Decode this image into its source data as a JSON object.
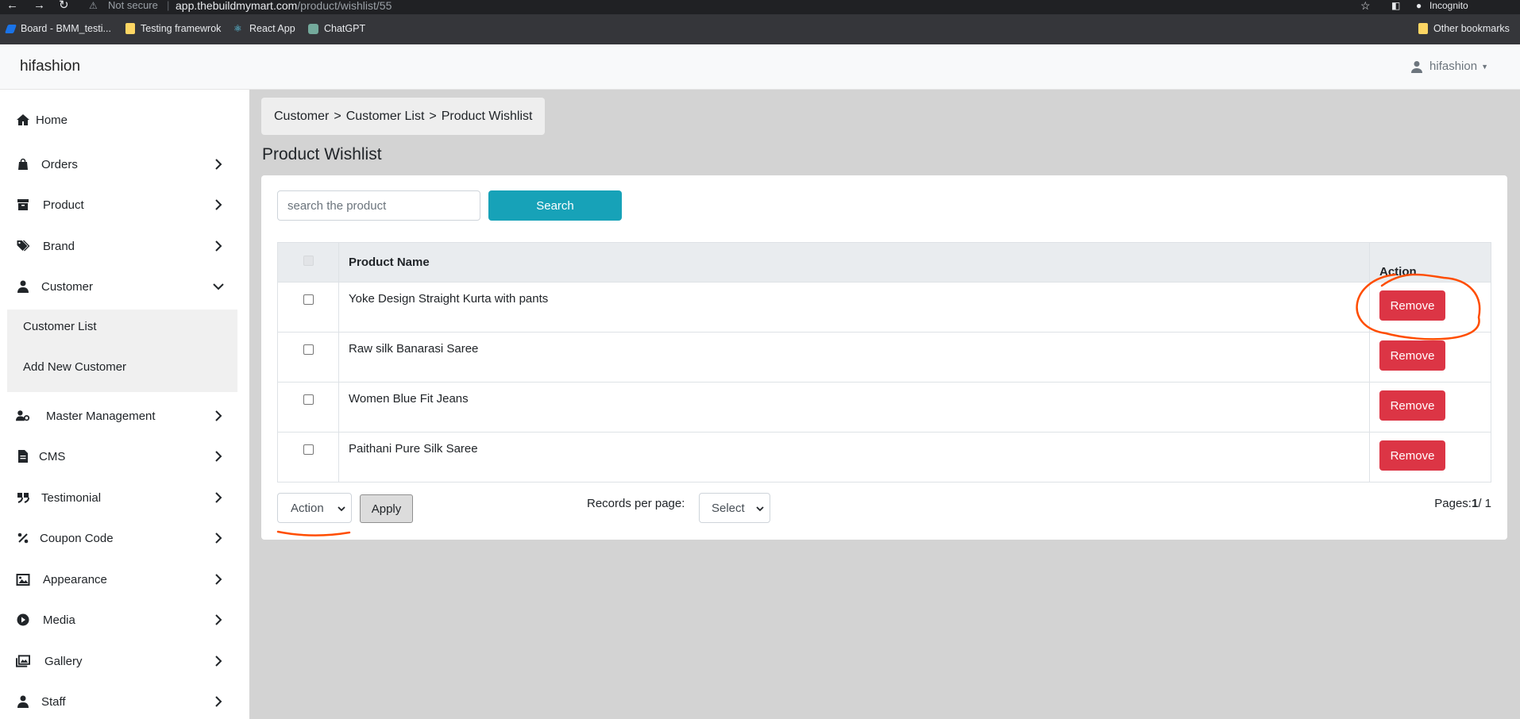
{
  "browser": {
    "not_secure": "Not secure",
    "url_host": "app.thebuildmymart.com",
    "url_path": "/product/wishlist/55",
    "profile": "Incognito",
    "bookmarks": [
      "Board - BMM_testi...",
      "Testing framewrok",
      "React App",
      "ChatGPT"
    ],
    "other_bookmarks": "Other bookmarks"
  },
  "header": {
    "brand": "hifashion",
    "user": "hifashion"
  },
  "sidebar": {
    "items": [
      {
        "label": "Home",
        "icon": "home-icon"
      },
      {
        "label": "Orders",
        "icon": "bag-icon"
      },
      {
        "label": "Product",
        "icon": "archive-icon"
      },
      {
        "label": "Brand",
        "icon": "tags-icon"
      },
      {
        "label": "Customer",
        "icon": "user-icon"
      },
      {
        "label": "Master Management",
        "icon": "user-cog-icon"
      },
      {
        "label": "CMS",
        "icon": "file-icon"
      },
      {
        "label": "Testimonial",
        "icon": "quote-icon"
      },
      {
        "label": "Coupon Code",
        "icon": "percent-icon"
      },
      {
        "label": "Appearance",
        "icon": "image-icon"
      },
      {
        "label": "Media",
        "icon": "play-circle-icon"
      },
      {
        "label": "Gallery",
        "icon": "images-icon"
      },
      {
        "label": "Staff",
        "icon": "user-icon"
      }
    ],
    "customer_submenu": [
      "Customer List",
      "Add New Customer"
    ]
  },
  "breadcrumb": [
    "Customer",
    "Customer List",
    "Product Wishlist"
  ],
  "page_title": "Product Wishlist",
  "search": {
    "placeholder": "search the product",
    "button": "Search"
  },
  "table": {
    "columns": [
      "Product Name",
      "Action"
    ],
    "rows": [
      {
        "name": "Yoke Design Straight Kurta with pants",
        "action": "Remove"
      },
      {
        "name": "Raw silk Banarasi Saree",
        "action": "Remove"
      },
      {
        "name": "Women Blue Fit Jeans",
        "action": "Remove"
      },
      {
        "name": "Paithani Pure Silk Saree",
        "action": "Remove"
      }
    ]
  },
  "footer": {
    "action_select": "Action",
    "apply": "Apply",
    "records_label": "Records per page:",
    "records_select": "Select",
    "pages_label": "Pages:",
    "current_page": "1",
    "total_pages": "/ 1"
  },
  "colors": {
    "search_button": "#17a2b8",
    "remove_button": "#dc3545",
    "annotation": "#ff4d00"
  }
}
